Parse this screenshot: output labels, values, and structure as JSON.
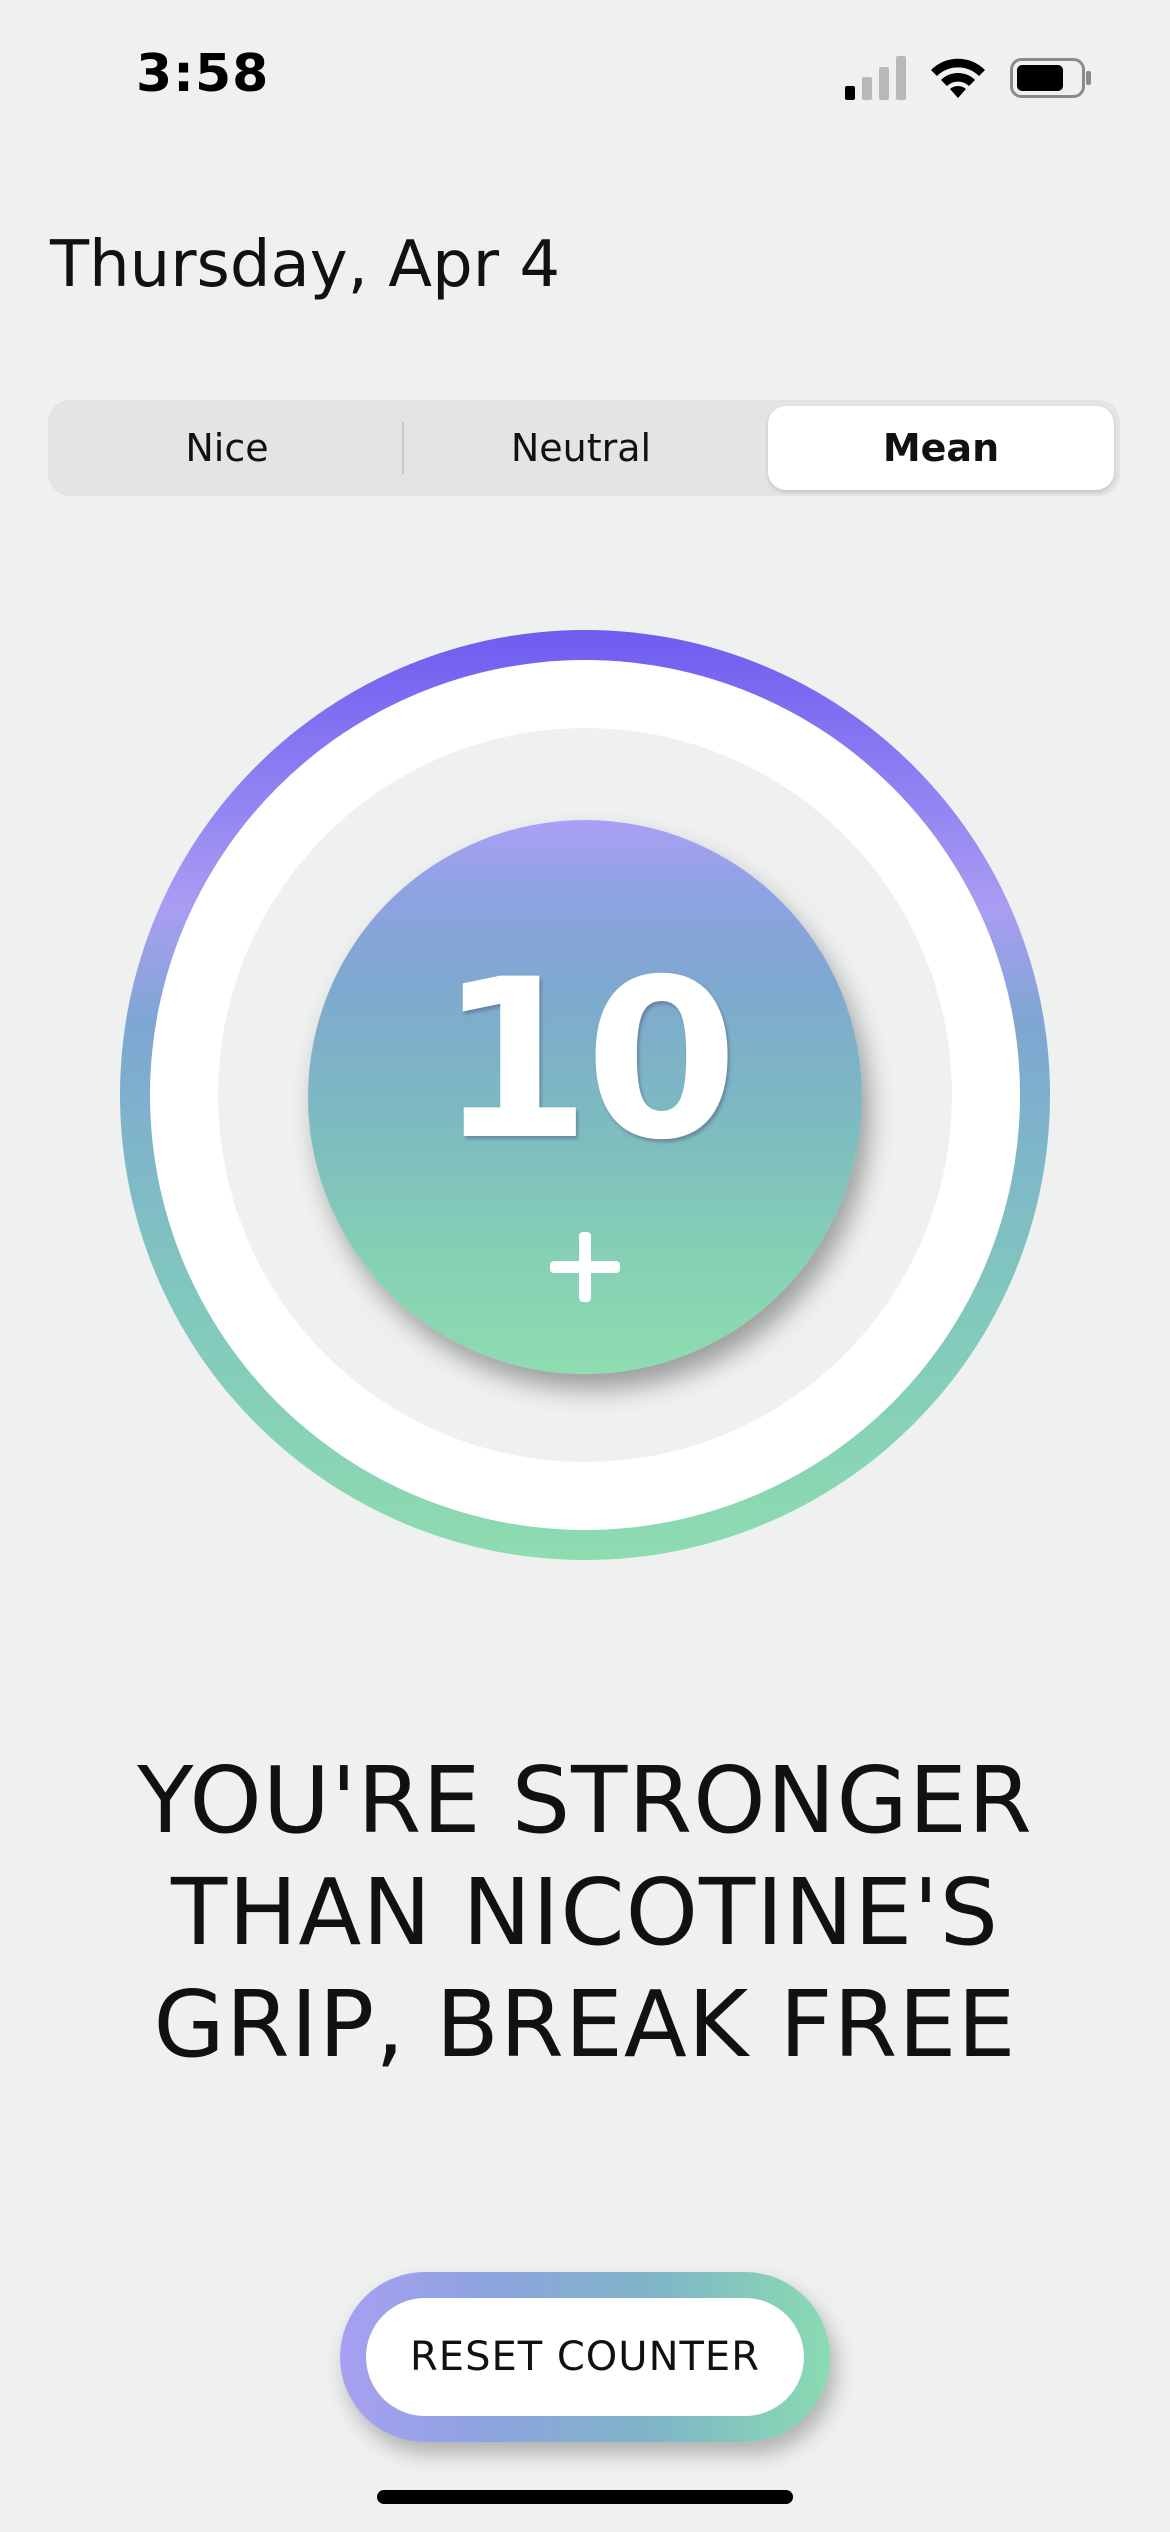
{
  "status_bar": {
    "time": "3:58",
    "icons": [
      "cellular-signal-icon",
      "wifi-icon",
      "battery-icon"
    ]
  },
  "header": {
    "date": "Thursday, Apr 4"
  },
  "tone_selector": {
    "options": [
      "Nice",
      "Neutral",
      "Mean"
    ],
    "selected": "Mean"
  },
  "counter": {
    "value": "10",
    "increment_icon": "plus-icon"
  },
  "message": {
    "lines": [
      "YOU'RE STRONGER",
      "THAN NICOTINE'S",
      "GRIP, BREAK FREE"
    ]
  },
  "actions": {
    "reset_label": "RESET COUNTER"
  },
  "colors": {
    "background": "#eff1f1",
    "gradient_top": "#6e5cf0",
    "gradient_mid": "#7ea9cf",
    "gradient_bottom": "#8edcaf",
    "selected_segment": "#ffffff"
  }
}
